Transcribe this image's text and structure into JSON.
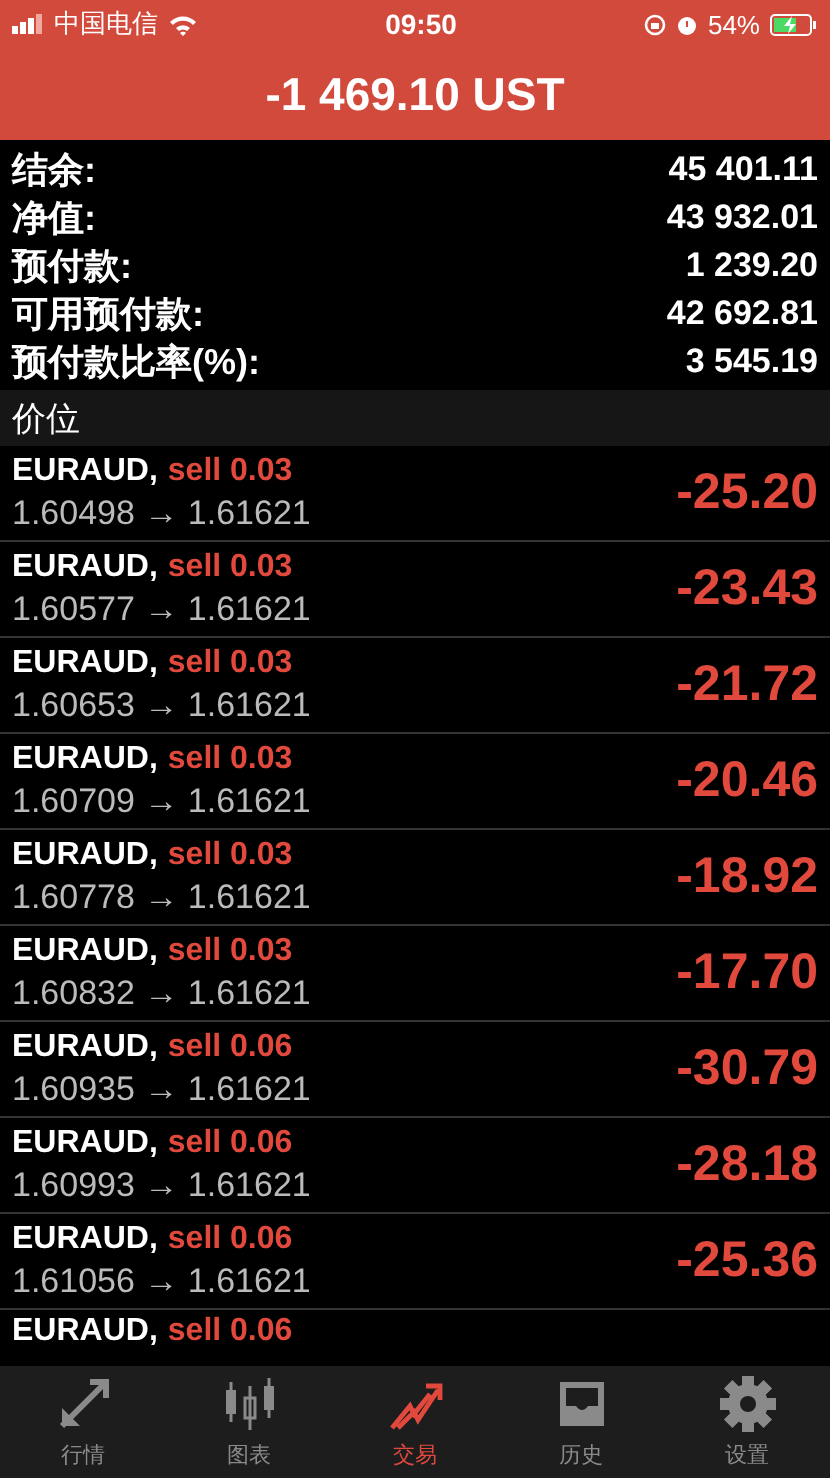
{
  "status_bar": {
    "carrier": "中国电信",
    "time": "09:50",
    "battery": "54%"
  },
  "header": {
    "title": "-1 469.10 UST"
  },
  "summary": [
    {
      "label": "结余:",
      "value": "45 401.11"
    },
    {
      "label": "净值:",
      "value": "43 932.01"
    },
    {
      "label": "预付款:",
      "value": "1 239.20"
    },
    {
      "label": "可用预付款:",
      "value": "42 692.81"
    },
    {
      "label": "预付款比率(%):",
      "value": "3 545.19"
    }
  ],
  "section_title": "价位",
  "positions": [
    {
      "symbol": "EURAUD,",
      "side": "sell 0.03",
      "prices": "1.60498 → 1.61621",
      "profit": "-25.20"
    },
    {
      "symbol": "EURAUD,",
      "side": "sell 0.03",
      "prices": "1.60577 → 1.61621",
      "profit": "-23.43"
    },
    {
      "symbol": "EURAUD,",
      "side": "sell 0.03",
      "prices": "1.60653 → 1.61621",
      "profit": "-21.72"
    },
    {
      "symbol": "EURAUD,",
      "side": "sell 0.03",
      "prices": "1.60709 → 1.61621",
      "profit": "-20.46"
    },
    {
      "symbol": "EURAUD,",
      "side": "sell 0.03",
      "prices": "1.60778 → 1.61621",
      "profit": "-18.92"
    },
    {
      "symbol": "EURAUD,",
      "side": "sell 0.03",
      "prices": "1.60832 → 1.61621",
      "profit": "-17.70"
    },
    {
      "symbol": "EURAUD,",
      "side": "sell 0.06",
      "prices": "1.60935 → 1.61621",
      "profit": "-30.79"
    },
    {
      "symbol": "EURAUD,",
      "side": "sell 0.06",
      "prices": "1.60993 → 1.61621",
      "profit": "-28.18"
    },
    {
      "symbol": "EURAUD,",
      "side": "sell 0.06",
      "prices": "1.61056 → 1.61621",
      "profit": "-25.36"
    },
    {
      "symbol": "EURAUD,",
      "side": "sell 0.06"
    }
  ],
  "tab_bar": [
    {
      "label": "行情",
      "kind": "quotes",
      "selected": false
    },
    {
      "label": "图表",
      "kind": "chart",
      "selected": false
    },
    {
      "label": "交易",
      "kind": "trade",
      "selected": true
    },
    {
      "label": "历史",
      "kind": "history",
      "selected": false
    },
    {
      "label": "设置",
      "kind": "settings",
      "selected": false
    }
  ]
}
